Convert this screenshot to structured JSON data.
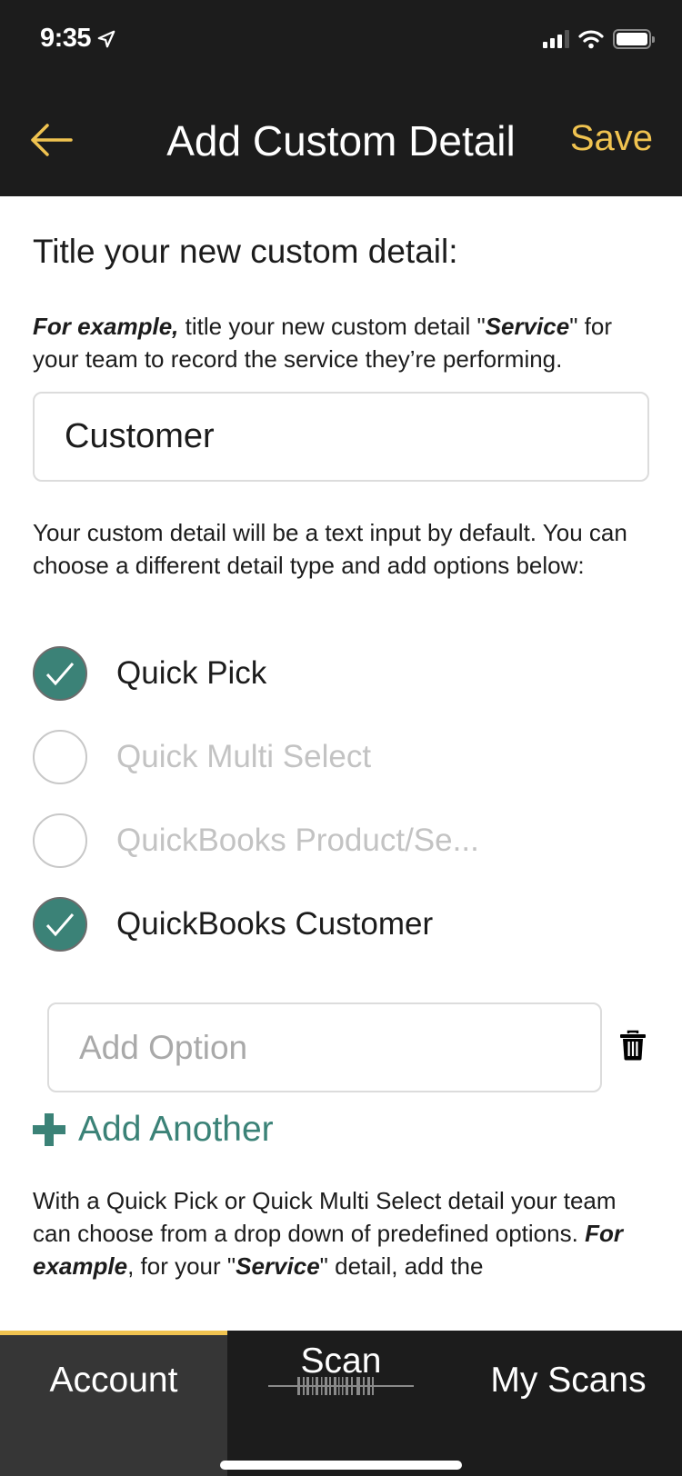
{
  "status_bar": {
    "time": "9:35",
    "location_icon": "location-arrow-icon",
    "signal_icon": "cellular-signal-icon",
    "wifi_icon": "wifi-icon",
    "battery_icon": "battery-full-icon"
  },
  "header": {
    "back_icon": "arrow-left-icon",
    "title": "Add Custom Detail",
    "save_label": "Save"
  },
  "form": {
    "heading": "Title your new custom detail:",
    "example_intro": {
      "bold_lead": "For example,",
      "text_1": " title your new custom detail \"",
      "bold_word": "Service",
      "text_2": "\" for your team to record the service they’re performing."
    },
    "title_input_value": "Customer",
    "type_description": "Your custom detail will be a text input by default. You can choose a different detail type and add options below:",
    "detail_types": [
      {
        "label": "Quick Pick",
        "checked": true,
        "enabled": true
      },
      {
        "label": "Quick Multi Select",
        "checked": false,
        "enabled": false
      },
      {
        "label": "QuickBooks Product/Se...",
        "checked": false,
        "enabled": false
      },
      {
        "label": "QuickBooks Customer",
        "checked": true,
        "enabled": true
      }
    ],
    "option_input_placeholder": "Add Option",
    "delete_icon": "trash-icon",
    "add_another_label": "Add Another",
    "add_icon": "plus-icon",
    "footer_note": {
      "text_1": "With a Quick Pick or Quick Multi Select detail your team can choose from a drop down of predefined options. ",
      "bold_lead": "For example",
      "text_2": ", for your \"",
      "bold_word": "Service",
      "text_3": "\" detail, add the"
    }
  },
  "tab_bar": {
    "tabs": [
      {
        "label": "Account",
        "active": true
      },
      {
        "label": "Scan",
        "icon": "barcode-icon",
        "active": false
      },
      {
        "label": "My Scans",
        "active": false
      }
    ]
  },
  "colors": {
    "header_bg": "#1c1c1c",
    "accent_yellow": "#f0c350",
    "accent_teal": "#3b8277",
    "disabled_text": "#c3c3c3",
    "active_tab_bg": "#363636"
  }
}
